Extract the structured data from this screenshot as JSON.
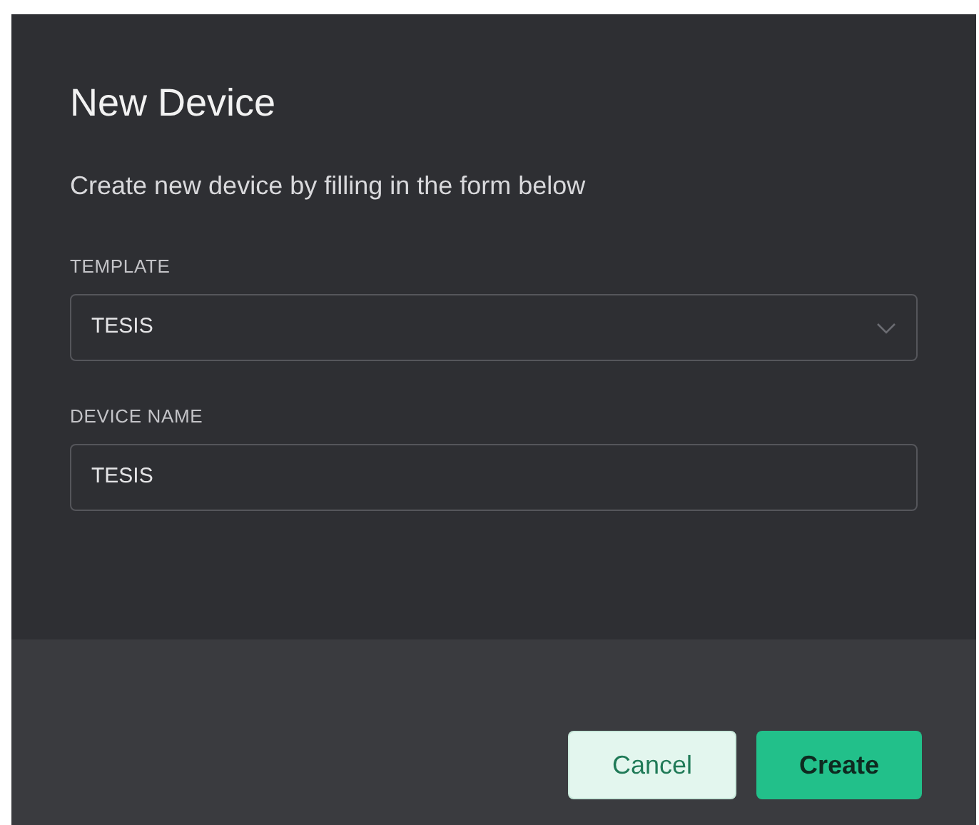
{
  "dialog": {
    "title": "New Device",
    "description": "Create new device by filling in the form below"
  },
  "fields": [
    {
      "kind": "select",
      "label": "TEMPLATE",
      "value": "TESIS"
    },
    {
      "kind": "text",
      "label": "DEVICE NAME",
      "value": "TESIS"
    }
  ],
  "buttons": [
    {
      "label": "Cancel",
      "kind": "secondary"
    },
    {
      "label": "Create",
      "kind": "primary"
    }
  ]
}
